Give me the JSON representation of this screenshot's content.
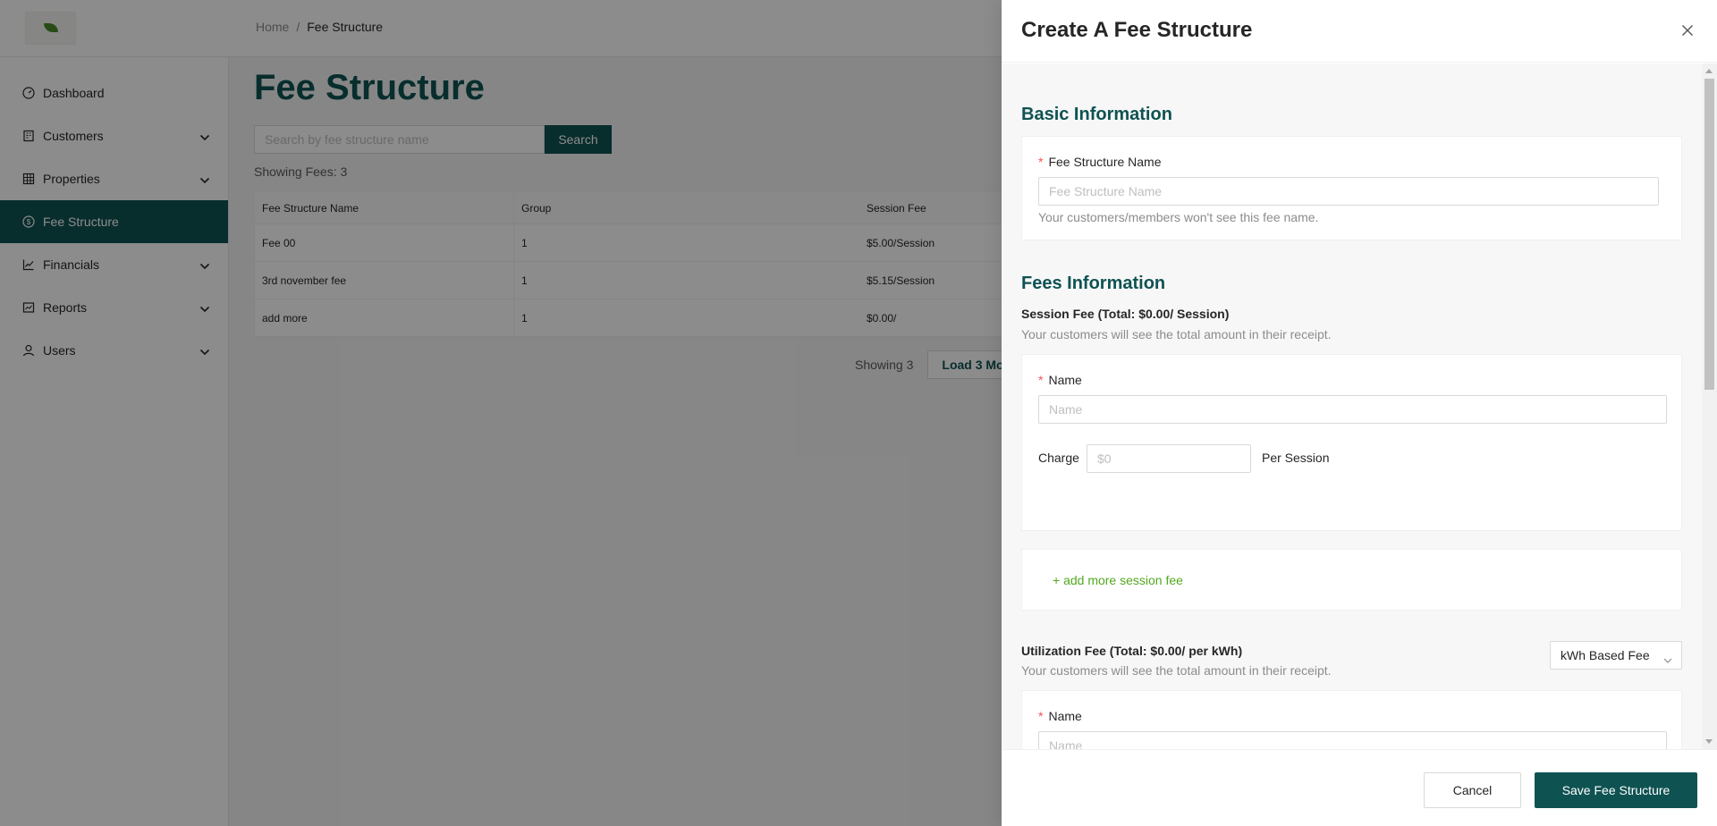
{
  "breadcrumb": {
    "home": "Home",
    "separator": "/",
    "current": "Fee Structure"
  },
  "sidebar": {
    "items": [
      {
        "label": "Dashboard",
        "icon": "dashboard-icon"
      },
      {
        "label": "Customers",
        "icon": "building-icon"
      },
      {
        "label": "Properties",
        "icon": "grid-icon"
      },
      {
        "label": "Fee Structure",
        "icon": "dollar-circle-icon"
      },
      {
        "label": "Financials",
        "icon": "line-chart-icon"
      },
      {
        "label": "Reports",
        "icon": "report-icon"
      },
      {
        "label": "Users",
        "icon": "user-icon"
      }
    ]
  },
  "main": {
    "title": "Fee Structure",
    "search_placeholder": "Search by fee structure name",
    "search_label": "Search",
    "showing_fees": "Showing Fees: 3",
    "table": {
      "headers": [
        "Fee Structure Name",
        "Group",
        "Session Fee"
      ],
      "rows": [
        [
          "Fee 00",
          "1",
          "$5.00/Session"
        ],
        [
          "3rd november fee",
          "1",
          "$5.15/Session"
        ],
        [
          "add more",
          "1",
          "$0.00/"
        ]
      ]
    },
    "pager_text": "Showing 3",
    "load_more_label": "Load 3 Mo"
  },
  "drawer": {
    "title": "Create A Fee Structure",
    "basic_section": "Basic Information",
    "fee_name_label": "Fee Structure Name",
    "fee_name_placeholder": "Fee Structure Name",
    "fee_name_help": "Your customers/members won't see this fee name.",
    "fees_section": "Fees Information",
    "session_fee_title": "Session Fee (Total: $0.00/ Session)",
    "receipt_help": "Your customers will see the total amount in their receipt.",
    "name_label": "Name",
    "name_placeholder": "Name",
    "charge_label": "Charge",
    "charge_placeholder": "$0",
    "per_session": "Per Session",
    "add_session_fee": "+ add more session fee",
    "utilization_title": "Utilization Fee (Total: $0.00/ per kWh)",
    "utilization_help": "Your customers will see the total amount in their receipt.",
    "fee_type_selected": "kWh Based Fee",
    "name_label_2": "Name",
    "name_placeholder_2": "Name",
    "cancel_label": "Cancel",
    "save_label": "Save Fee Structure"
  },
  "colors": {
    "primary": "#0f5252",
    "required": "#ff4d4f",
    "link": "#52a81f"
  }
}
